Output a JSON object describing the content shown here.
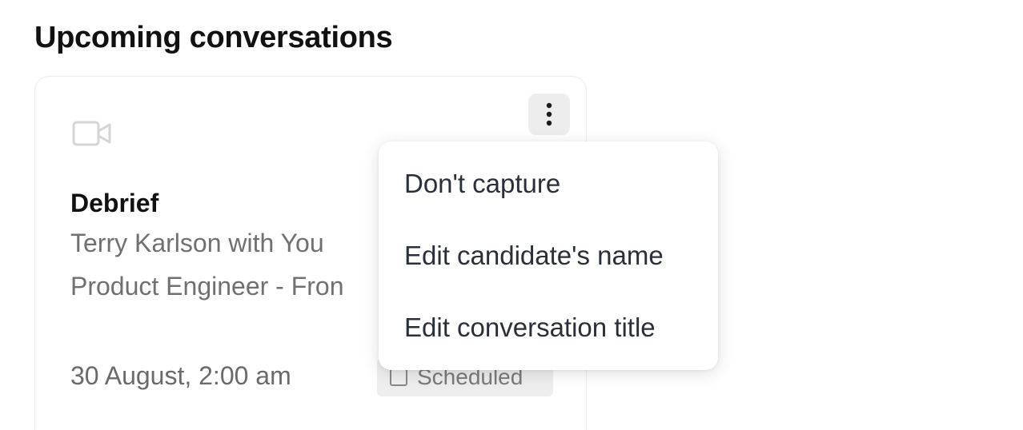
{
  "section": {
    "title": "Upcoming conversations"
  },
  "card": {
    "icon": "video-camera-icon",
    "more_icon": "more-vertical-icon",
    "title": "Debrief",
    "participants": "Terry Karlson with You",
    "role": "Product Engineer - Fron",
    "datetime": "30 August, 2:00 am",
    "status": {
      "icon": "calendar-icon",
      "label": "Scheduled"
    }
  },
  "menu": {
    "items": [
      {
        "label": "Don't capture"
      },
      {
        "label": "Edit candidate's name"
      },
      {
        "label": "Edit conversation title"
      }
    ]
  },
  "colors": {
    "icon_gray": "#d5d5d5",
    "badge_bg": "#eeeeee",
    "more_button_bg": "#ededed",
    "muted_text": "#707070"
  }
}
